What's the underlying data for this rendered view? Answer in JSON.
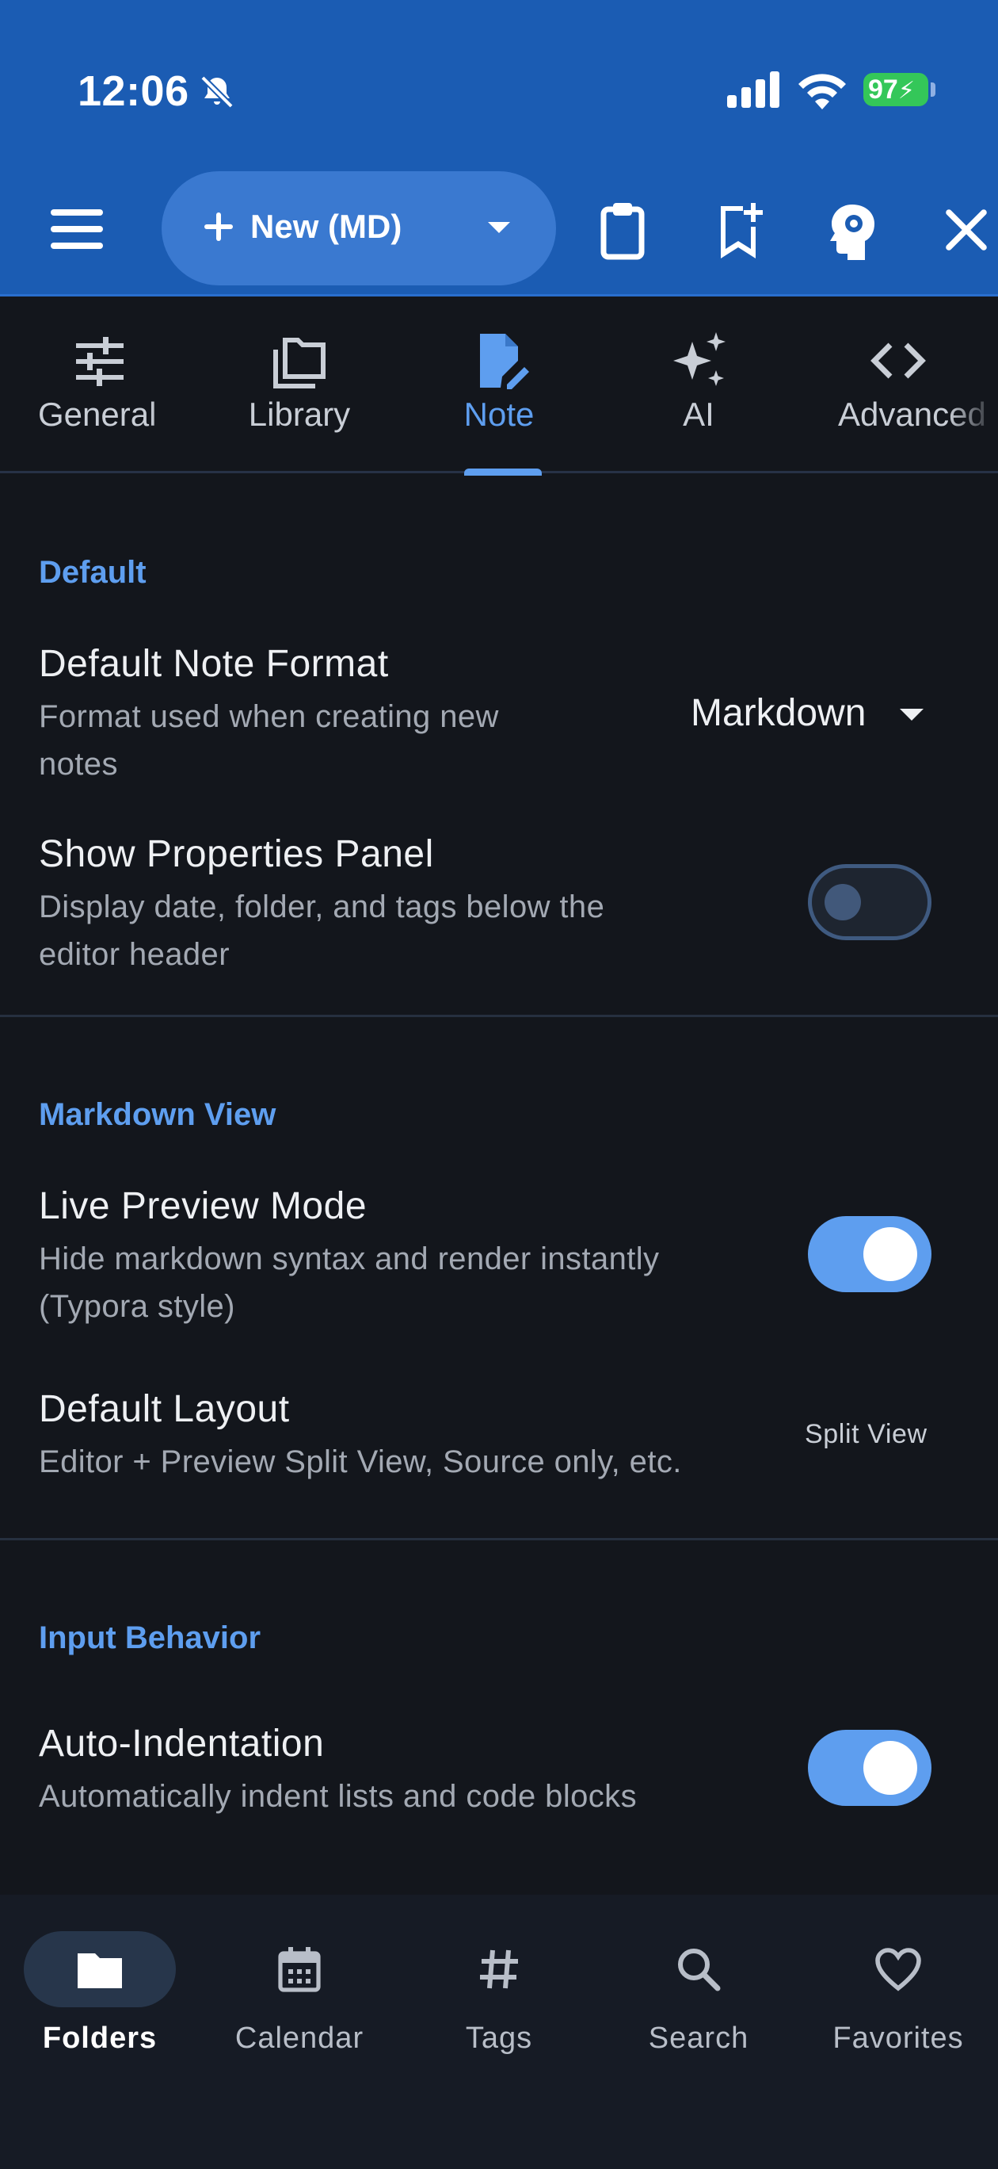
{
  "status_bar": {
    "time": "12:06",
    "battery": "97"
  },
  "toolbar": {
    "new_button_label": "New (MD)"
  },
  "tabs": [
    {
      "label": "General",
      "icon": "sliders-icon"
    },
    {
      "label": "Library",
      "icon": "folders-icon"
    },
    {
      "label": "Note",
      "icon": "note-edit-icon",
      "active": true
    },
    {
      "label": "AI",
      "icon": "sparkles-icon"
    },
    {
      "label": "Advanced",
      "icon": "code-icon"
    }
  ],
  "sections": {
    "default": {
      "title": "Default",
      "note_format": {
        "title": "Default Note Format",
        "desc_1": "Format used when creating new",
        "desc_2": "notes",
        "value": "Markdown"
      },
      "properties_panel": {
        "title": "Show Properties Panel",
        "desc_1": "Display date, folder, and tags below the",
        "desc_2": "editor header",
        "enabled": false
      }
    },
    "markdown_view": {
      "title": "Markdown View",
      "live_preview": {
        "title": "Live Preview Mode",
        "desc_1": "Hide markdown syntax and render instantly",
        "desc_2": "(Typora style)",
        "enabled": true
      },
      "default_layout": {
        "title": "Default Layout",
        "desc": "Editor + Preview Split View, Source only, etc.",
        "value": "Split View"
      }
    },
    "input_behavior": {
      "title": "Input Behavior",
      "auto_indent": {
        "title": "Auto-Indentation",
        "desc": "Automatically indent lists and code blocks",
        "enabled": true
      }
    }
  },
  "bottom_nav": [
    {
      "label": "Folders",
      "active": true
    },
    {
      "label": "Calendar"
    },
    {
      "label": "Tags"
    },
    {
      "label": "Search"
    },
    {
      "label": "Favorites"
    }
  ],
  "colors": {
    "header": "#1b5cb3",
    "accent": "#5e9eef",
    "background": "#13161c",
    "battery": "#34c759"
  }
}
